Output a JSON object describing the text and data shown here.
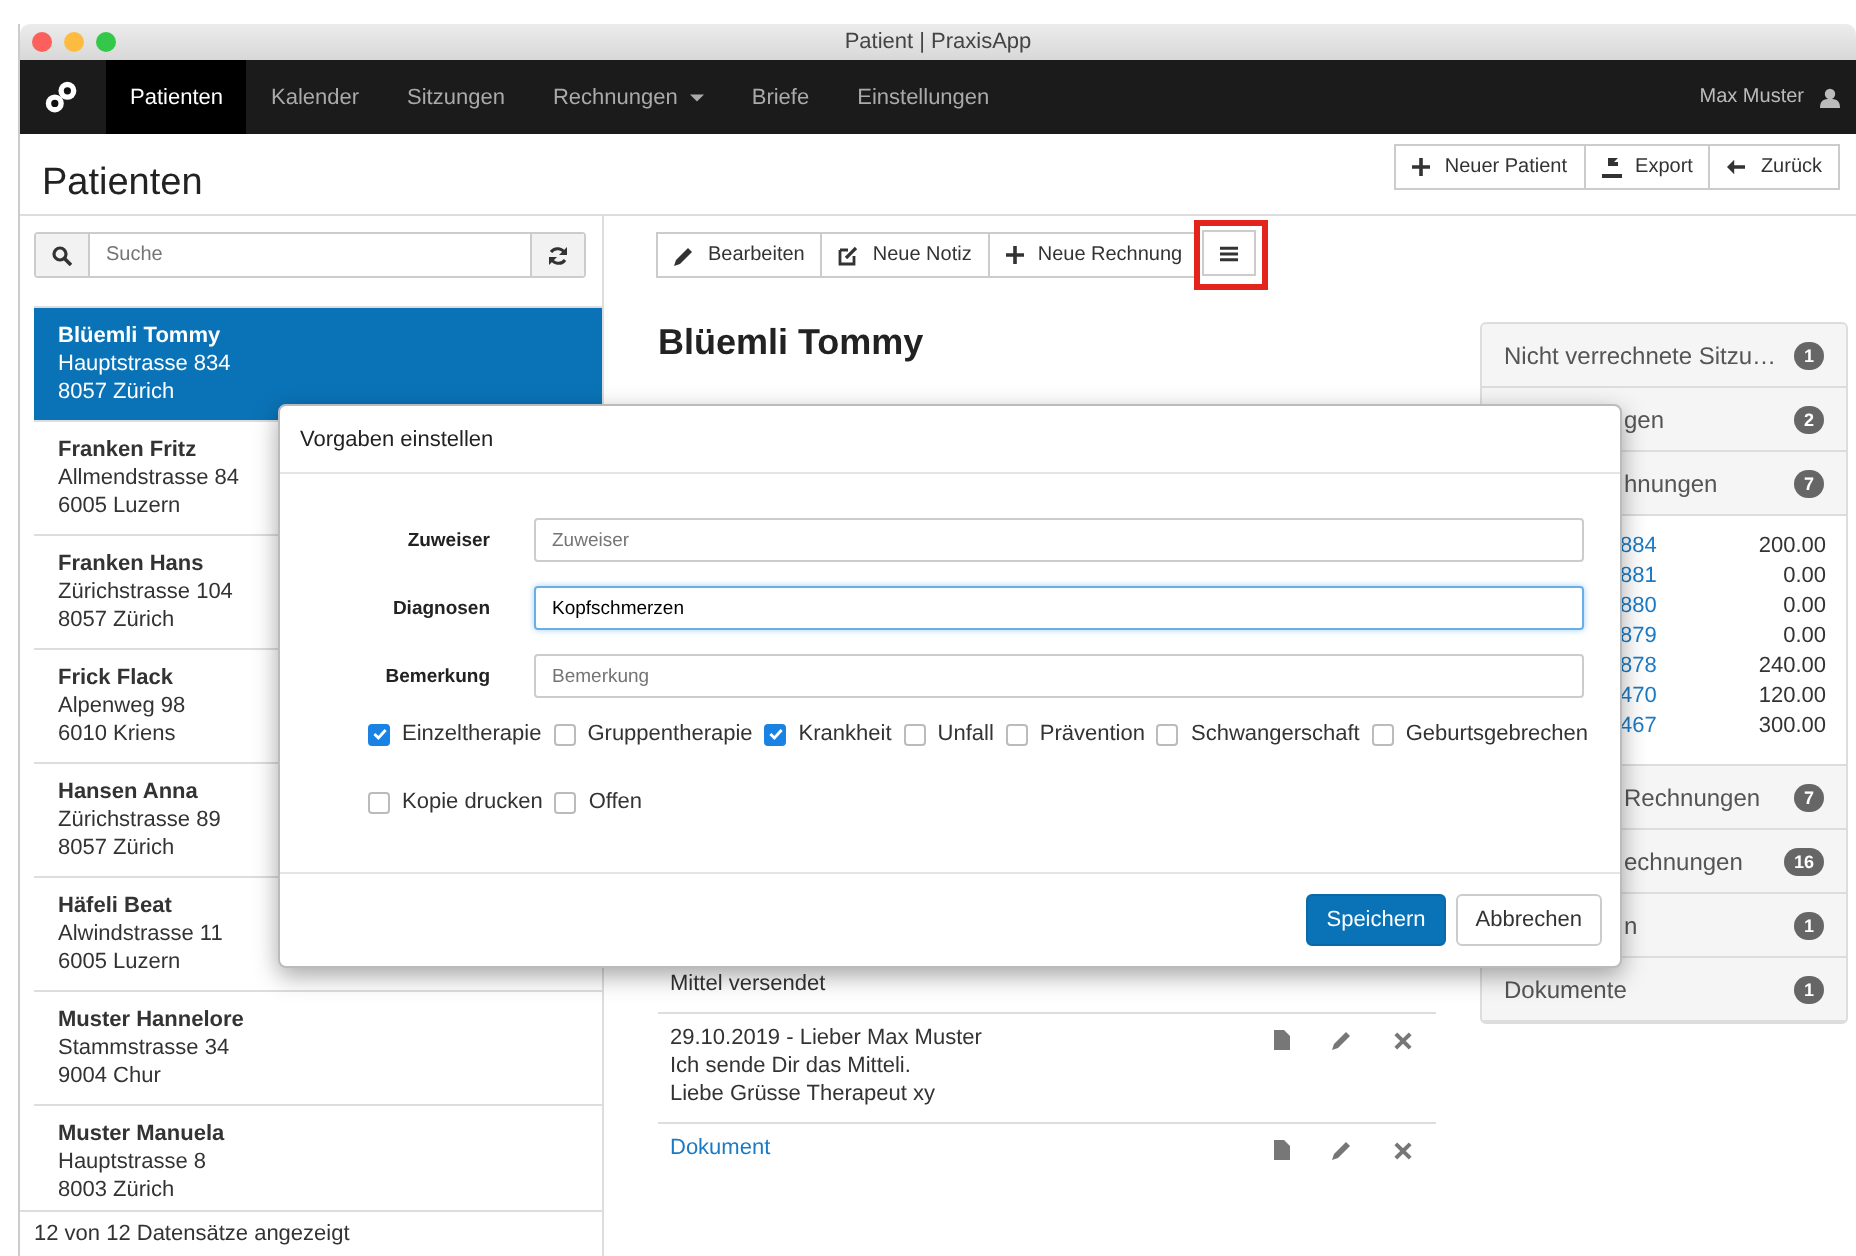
{
  "window": {
    "title": "Patient | PraxisApp"
  },
  "nav": {
    "items": [
      {
        "label": "Patienten",
        "selected": true,
        "dropdown": false
      },
      {
        "label": "Kalender",
        "selected": false,
        "dropdown": false
      },
      {
        "label": "Sitzungen",
        "selected": false,
        "dropdown": false
      },
      {
        "label": "Rechnungen",
        "selected": false,
        "dropdown": true
      },
      {
        "label": "Briefe",
        "selected": false,
        "dropdown": false
      },
      {
        "label": "Einstellungen",
        "selected": false,
        "dropdown": false
      }
    ],
    "user": "Max Muster"
  },
  "page": {
    "title": "Patienten",
    "actions": [
      {
        "kind": "plus",
        "label": "Neuer Patient"
      },
      {
        "kind": "export",
        "label": "Export"
      },
      {
        "kind": "back",
        "label": "Zurück"
      }
    ]
  },
  "sidebar": {
    "search": {
      "placeholder": "Suche"
    },
    "patients": [
      {
        "name": "Blüemli Tommy",
        "street": "Hauptstrasse 834",
        "city": "8057 Zürich",
        "selected": true
      },
      {
        "name": "Franken Fritz",
        "street": "Allmendstrasse 84",
        "city": "6005 Luzern",
        "selected": false
      },
      {
        "name": "Franken Hans",
        "street": "Zürichstrasse 104",
        "city": "8057 Zürich",
        "selected": false
      },
      {
        "name": "Frick Flack",
        "street": "Alpenweg 98",
        "city": "6010 Kriens",
        "selected": false
      },
      {
        "name": "Hansen Anna",
        "street": "Zürichstrasse 89",
        "city": "8057 Zürich",
        "selected": false
      },
      {
        "name": "Häfeli Beat",
        "street": "Alwindstrasse 11",
        "city": "6005 Luzern",
        "selected": false
      },
      {
        "name": "Muster Hannelore",
        "street": "Stammstrasse 34",
        "city": "9004 Chur",
        "selected": false
      },
      {
        "name": "Muster Manuela",
        "street": "Hauptstrasse 8",
        "city": "8003 Zürich",
        "selected": false
      }
    ],
    "footer": "12 von 12 Datensätze angezeigt"
  },
  "toolbar": [
    {
      "kind": "pencil",
      "label": "Bearbeiten"
    },
    {
      "kind": "note",
      "label": "Neue Notiz"
    },
    {
      "kind": "plus",
      "label": "Neue Rechnung"
    },
    {
      "kind": "menu",
      "highlighted": true
    }
  ],
  "patient": {
    "name": "Blüemli Tommy",
    "notes": [
      {
        "kind": "text",
        "lines": [
          "Mittel versendet"
        ],
        "actions": false
      },
      {
        "kind": "text",
        "lines": [
          "29.10.2019 - Lieber Max Muster",
          "Ich sende Dir das Mitteli.",
          "Liebe Grüsse Therapeut xy"
        ],
        "actions": true
      },
      {
        "kind": "link",
        "lines": [
          "Dokument"
        ],
        "actions": true
      }
    ]
  },
  "panel": [
    {
      "label": "Nicht verrechnete Sitzu…",
      "count": "1"
    },
    {
      "label": "gen",
      "count": "2"
    },
    {
      "label": "hnungen",
      "count": "7",
      "invoices": [
        {
          "number": "884",
          "amount": "200.00"
        },
        {
          "number": "881",
          "amount": "0.00"
        },
        {
          "number": "880",
          "amount": "0.00"
        },
        {
          "number": "879",
          "amount": "0.00"
        },
        {
          "number": "878",
          "amount": "240.00"
        },
        {
          "number": "470",
          "amount": "120.00"
        },
        {
          "number": "467",
          "amount": "300.00"
        }
      ]
    },
    {
      "label": "Rechnungen",
      "count": "7"
    },
    {
      "label": "echnungen",
      "count": "16"
    },
    {
      "label": "n",
      "count": "1"
    },
    {
      "label": "Dokumente",
      "count": "1"
    }
  ],
  "modal": {
    "title": "Vorgaben einstellen",
    "fields": [
      {
        "label": "Zuweiser",
        "placeholder": "Zuweiser",
        "focused": false
      },
      {
        "label": "Diagnosen",
        "value": "Kopfschmerzen",
        "focused": true
      },
      {
        "label": "Bemerkung",
        "placeholder": "Bemerkung",
        "focused": false
      }
    ],
    "options": [
      [
        {
          "label": "Einzeltherapie",
          "checked": true
        },
        {
          "label": "Gruppentherapie",
          "checked": false
        },
        {
          "label": "Krankheit",
          "checked": true
        },
        {
          "label": "Unfall",
          "checked": false
        },
        {
          "label": "Prävention",
          "checked": false
        },
        {
          "label": "Schwangerschaft",
          "checked": false
        },
        {
          "label": "Geburtsgebrechen",
          "checked": false
        }
      ],
      [
        {
          "label": "Kopie drucken",
          "checked": false
        },
        {
          "label": "Offen",
          "checked": false
        }
      ]
    ],
    "buttons": [
      {
        "kind": "primary",
        "label": "Speichern"
      },
      {
        "kind": "default",
        "label": "Abbrechen"
      }
    ]
  }
}
